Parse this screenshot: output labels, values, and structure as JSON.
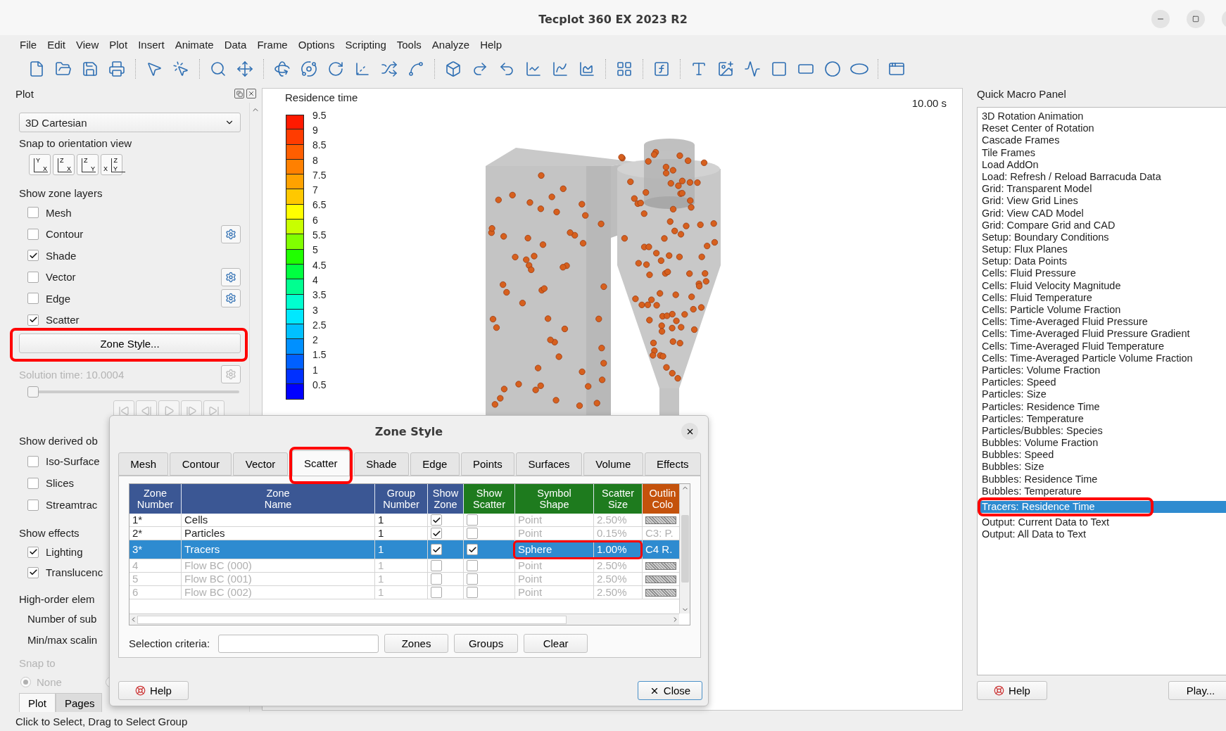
{
  "window": {
    "title": "Tecplot 360 EX 2023 R2"
  },
  "menu": [
    "File",
    "Edit",
    "View",
    "Plot",
    "Insert",
    "Animate",
    "Data",
    "Frame",
    "Options",
    "Scripting",
    "Tools",
    "Analyze",
    "Help"
  ],
  "plot_panel": {
    "title": "Plot",
    "plot_type": "3D Cartesian",
    "snap_label": "Snap to orientation view",
    "orientation_buttons": [
      {
        "labels": [
          "Y",
          "X"
        ]
      },
      {
        "labels": [
          "Z",
          "X"
        ]
      },
      {
        "labels": [
          "Z",
          "Y"
        ]
      },
      {
        "labels": [
          "X",
          "Z",
          "Y"
        ]
      }
    ],
    "zone_layers_label": "Show zone layers",
    "zone_layers": [
      {
        "label": "Mesh",
        "checked": false,
        "has_settings": false
      },
      {
        "label": "Contour",
        "checked": false,
        "has_settings": true
      },
      {
        "label": "Shade",
        "checked": true,
        "has_settings": false
      },
      {
        "label": "Vector",
        "checked": false,
        "has_settings": true
      },
      {
        "label": "Edge",
        "checked": false,
        "has_settings": true
      },
      {
        "label": "Scatter",
        "checked": true,
        "has_settings": false
      }
    ],
    "zone_style_button": {
      "label": "Zone Style...",
      "highlighted": true
    },
    "solution_time": {
      "label": "Solution time: 10.0004",
      "disabled": true
    },
    "time_slider": {
      "level": 0
    },
    "derived_label": "Show derived ob",
    "derived": [
      {
        "label": "Iso-Surface",
        "checked": false
      },
      {
        "label": "Slices",
        "checked": false
      },
      {
        "label": "Streamtrac",
        "checked": false
      }
    ],
    "effects_label": "Show effects",
    "effects": [
      {
        "label": "Lighting",
        "checked": true
      },
      {
        "label": "Translucenc",
        "checked": true
      }
    ],
    "high_order_label": "High-order elem",
    "high_order_rows": [
      "Number of sub",
      "Min/max scalin"
    ],
    "snap_to": {
      "label": "Snap to",
      "disabled": true,
      "options": [
        {
          "label": "None",
          "selected": true
        },
        {
          "selected": false
        }
      ]
    },
    "tabs": [
      {
        "label": "Plot",
        "selected": true
      },
      {
        "label": "Pages",
        "selected": false
      }
    ]
  },
  "plot": {
    "legend": {
      "title": "Residence time",
      "levels": [
        {
          "label": "9.5",
          "color": "#ff1a00"
        },
        {
          "label": "9",
          "color": "#ff3c00"
        },
        {
          "label": "8.5",
          "color": "#ff5e00"
        },
        {
          "label": "8",
          "color": "#ff8000"
        },
        {
          "label": "7.5",
          "color": "#ffa200"
        },
        {
          "label": "7",
          "color": "#ffc800"
        },
        {
          "label": "6.5",
          "color": "#ffff00"
        },
        {
          "label": "6",
          "color": "#c8ff00"
        },
        {
          "label": "5.5",
          "color": "#80ff00"
        },
        {
          "label": "5",
          "color": "#20ff00"
        },
        {
          "label": "4.5",
          "color": "#00ff40"
        },
        {
          "label": "4",
          "color": "#00ff90"
        },
        {
          "label": "3.5",
          "color": "#00ffd0"
        },
        {
          "label": "3",
          "color": "#00e8ff"
        },
        {
          "label": "2.5",
          "color": "#00c0ff"
        },
        {
          "label": "2",
          "color": "#0090ff"
        },
        {
          "label": "1.5",
          "color": "#0060ff"
        },
        {
          "label": "1",
          "color": "#0030ff"
        },
        {
          "label": "0.5",
          "color": "#0000ff"
        }
      ]
    },
    "time": "10.00 s"
  },
  "macro_panel": {
    "title": "Quick Macro Panel",
    "items": [
      {
        "label": "3D Rotation Animation",
        "selected": false
      },
      {
        "label": "Reset Center of Rotation",
        "selected": false
      },
      {
        "label": "Cascade Frames",
        "selected": false
      },
      {
        "label": "Tile Frames",
        "selected": false
      },
      {
        "label": "Load AddOn",
        "selected": false
      },
      {
        "label": "Load: Refresh / Reload Barracuda Data",
        "selected": false
      },
      {
        "label": "Grid: Transparent Model",
        "selected": false
      },
      {
        "label": "Grid: View Grid Lines",
        "selected": false
      },
      {
        "label": "Grid: View CAD Model",
        "selected": false
      },
      {
        "label": "Grid: Compare Grid and CAD",
        "selected": false
      },
      {
        "label": "Setup: Boundary Conditions",
        "selected": false
      },
      {
        "label": "Setup: Flux Planes",
        "selected": false
      },
      {
        "label": "Setup: Data Points",
        "selected": false
      },
      {
        "label": "Cells: Fluid Pressure",
        "selected": false
      },
      {
        "label": "Cells: Fluid Velocity Magnitude",
        "selected": false
      },
      {
        "label": "Cells: Fluid Temperature",
        "selected": false
      },
      {
        "label": "Cells: Particle Volume Fraction",
        "selected": false
      },
      {
        "label": "Cells: Time-Averaged Fluid Pressure",
        "selected": false
      },
      {
        "label": "Cells: Time-Averaged Fluid Pressure Gradient",
        "selected": false
      },
      {
        "label": "Cells: Time-Averaged Fluid Temperature",
        "selected": false
      },
      {
        "label": "Cells: Time-Averaged Particle Volume Fraction",
        "selected": false
      },
      {
        "label": "Particles: Volume Fraction",
        "selected": false
      },
      {
        "label": "Particles: Speed",
        "selected": false
      },
      {
        "label": "Particles: Size",
        "selected": false
      },
      {
        "label": "Particles: Residence Time",
        "selected": false
      },
      {
        "label": "Particles: Temperature",
        "selected": false
      },
      {
        "label": "Particles/Bubbles: Species",
        "selected": false
      },
      {
        "label": "Bubbles: Volume Fraction",
        "selected": false
      },
      {
        "label": "Bubbles: Speed",
        "selected": false
      },
      {
        "label": "Bubbles: Size",
        "selected": false
      },
      {
        "label": "Bubbles: Residence Time",
        "selected": false
      },
      {
        "label": "Bubbles: Temperature",
        "selected": false
      },
      {
        "label": "Tracers: Residence Time",
        "selected": true,
        "highlighted": true
      },
      {
        "label": "Output: Current Data to Text",
        "selected": false
      },
      {
        "label": "Output: All Data to Text",
        "selected": false
      }
    ],
    "help_button": "Help",
    "play_button": "Play..."
  },
  "zone_style_dialog": {
    "title": "Zone Style",
    "tabs": [
      {
        "label": "Mesh",
        "selected": false
      },
      {
        "label": "Contour",
        "selected": false
      },
      {
        "label": "Vector",
        "selected": false
      },
      {
        "label": "Scatter",
        "selected": true,
        "highlighted": true
      },
      {
        "label": "Shade",
        "selected": false
      },
      {
        "label": "Edge",
        "selected": false
      },
      {
        "label": "Points",
        "selected": false
      },
      {
        "label": "Surfaces",
        "selected": false
      },
      {
        "label": "Volume",
        "selected": false
      },
      {
        "label": "Effects",
        "selected": false
      }
    ],
    "columns": [
      {
        "lines": [
          "Zone",
          "Number"
        ],
        "color": "#3b5794"
      },
      {
        "lines": [
          "Zone",
          "Name"
        ],
        "color": "#3b5794"
      },
      {
        "lines": [
          "Group",
          "Number"
        ],
        "color": "#3b5794"
      },
      {
        "lines": [
          "Show",
          "Zone"
        ],
        "color": "#3b5794"
      },
      {
        "lines": [
          "Show",
          "Scatter"
        ],
        "color": "#1e7b1e"
      },
      {
        "lines": [
          "Symbol",
          "Shape"
        ],
        "color": "#1e7b1e"
      },
      {
        "lines": [
          "Scatter",
          "Size"
        ],
        "color": "#1e7b1e"
      },
      {
        "lines": [
          "Outlin",
          "Colo"
        ],
        "color": "#c4520c"
      }
    ],
    "rows": [
      {
        "number": "1*",
        "name": "Cells",
        "group": "1",
        "show_zone": true,
        "show_scatter": false,
        "shape": "Point",
        "size": "2.50%",
        "outline": {
          "kind": "swatch"
        },
        "enabled": true,
        "selected": false
      },
      {
        "number": "2*",
        "name": "Particles",
        "group": "1",
        "show_zone": true,
        "show_scatter": false,
        "shape": "Point",
        "size": "0.15%",
        "outline": {
          "kind": "text",
          "text": "C3: P."
        },
        "enabled": true,
        "selected": false
      },
      {
        "number": "3*",
        "name": "Tracers",
        "group": "1",
        "show_zone": true,
        "show_scatter": true,
        "shape": "Sphere",
        "size": "1.00%",
        "outline": {
          "kind": "text",
          "text": "C4 R."
        },
        "enabled": true,
        "selected": true,
        "highlighted": true
      },
      {
        "number": "4",
        "name": "Flow BC (000)",
        "group": "1",
        "show_zone": false,
        "show_scatter": false,
        "shape": "Point",
        "size": "2.50%",
        "outline": {
          "kind": "swatch"
        },
        "enabled": false,
        "selected": false
      },
      {
        "number": "5",
        "name": "Flow BC (001)",
        "group": "1",
        "show_zone": false,
        "show_scatter": false,
        "shape": "Point",
        "size": "2.50%",
        "outline": {
          "kind": "swatch"
        },
        "enabled": false,
        "selected": false
      },
      {
        "number": "6",
        "name": "Flow BC (002)",
        "group": "1",
        "show_zone": false,
        "show_scatter": false,
        "shape": "Point",
        "size": "2.50%",
        "outline": {
          "kind": "swatch"
        },
        "enabled": false,
        "selected": false
      }
    ],
    "selection_label": "Selection criteria:",
    "selection_buttons": [
      "Zones",
      "Groups",
      "Clear"
    ],
    "help_button": "Help",
    "close_button": "Close"
  },
  "status_bar": "Click to Select, Drag to Select Group"
}
